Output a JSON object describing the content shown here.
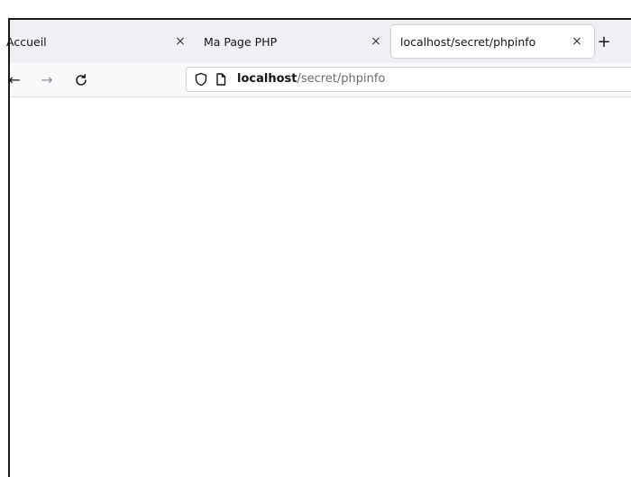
{
  "tabs": [
    {
      "label": "Accueil",
      "close": "×"
    },
    {
      "label": "Ma Page PHP",
      "close": "×"
    },
    {
      "label": "localhost/secret/phpinfo",
      "close": "×",
      "active": true
    }
  ],
  "new_tab_label": "+",
  "nav": {
    "back": "←",
    "forward": "→",
    "reload": "C"
  },
  "url": {
    "host": "localhost",
    "path": "/secret/phpinfo"
  },
  "icons": {
    "url_left": "shield-icon",
    "url_page": "page-icon"
  },
  "colors": {
    "tabstrip": "#f0f0f4",
    "active_tab": "#ffffff",
    "navbar": "#f9f9fb",
    "text": "#15141a",
    "url_path": "#6b6a75"
  }
}
